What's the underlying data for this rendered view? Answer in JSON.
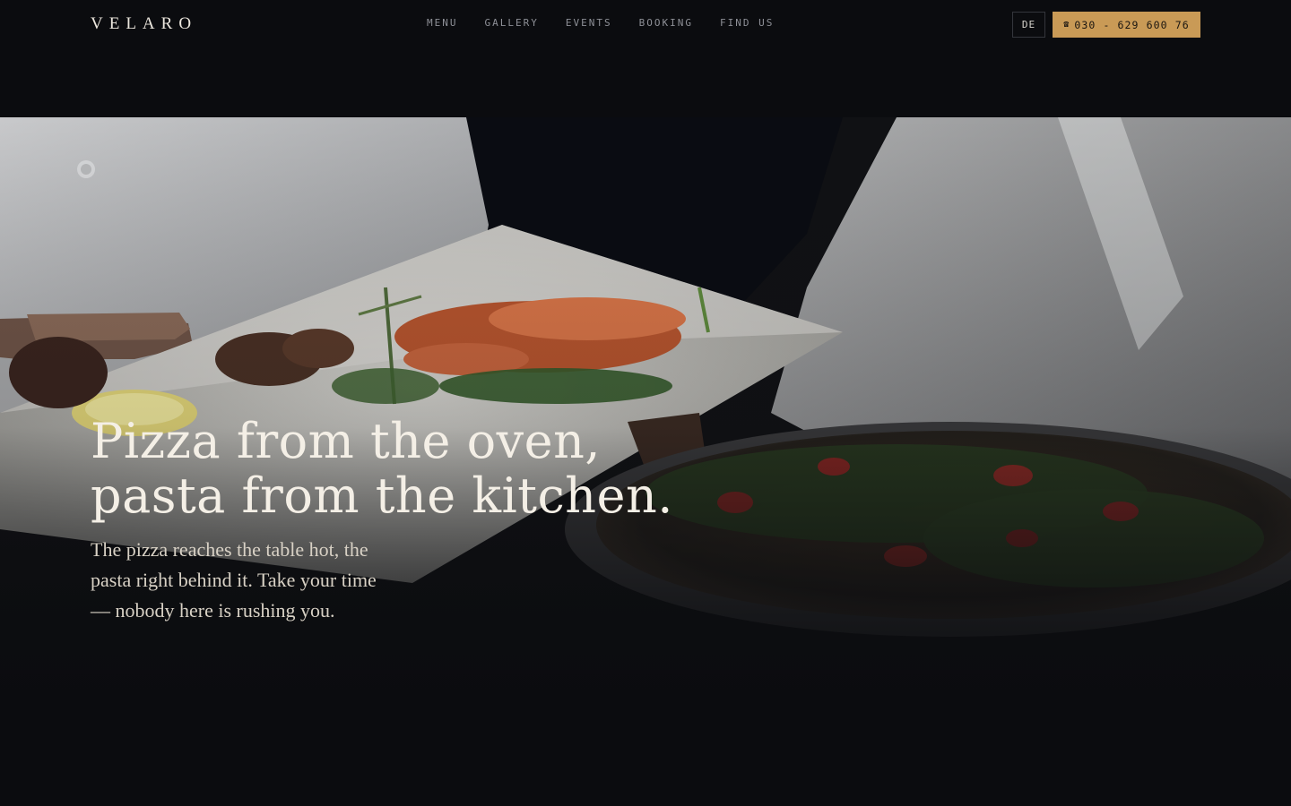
{
  "brand": {
    "logo_text": "VELARO"
  },
  "nav": {
    "items": [
      {
        "label": "MENU"
      },
      {
        "label": "GALLERY"
      },
      {
        "label": "EVENTS"
      },
      {
        "label": "BOOKING"
      },
      {
        "label": "FIND US"
      }
    ]
  },
  "header_actions": {
    "language_label": "DE",
    "phone_icon": "phone-icon",
    "phone_label": "030 - 629 600 76"
  },
  "hero": {
    "headline_line1": "Pizza from the oven,",
    "headline_line2": "pasta from the kitchen.",
    "subcopy": "The pizza reaches the table hot, the pasta right behind it. Take your time — nobody here is rushing you."
  },
  "colors": {
    "background": "#0b0c0f",
    "accent": "#c99a56",
    "nav_text": "#8e9097",
    "headline_text": "#f4efe6"
  }
}
